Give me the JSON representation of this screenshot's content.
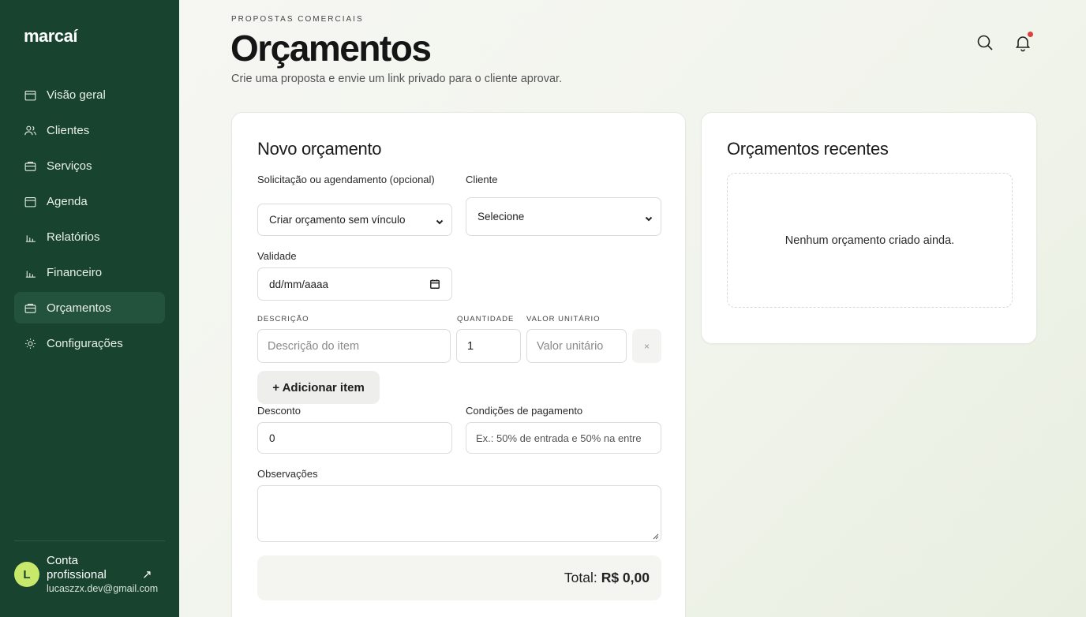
{
  "sidebar": {
    "logo": "marcaí",
    "items": [
      {
        "label": "Visão geral",
        "icon": "calendar-icon"
      },
      {
        "label": "Clientes",
        "icon": "users-icon"
      },
      {
        "label": "Serviços",
        "icon": "briefcase-icon"
      },
      {
        "label": "Agenda",
        "icon": "calendar-icon"
      },
      {
        "label": "Relatórios",
        "icon": "bar-chart-icon"
      },
      {
        "label": "Financeiro",
        "icon": "bar-chart-icon"
      },
      {
        "label": "Orçamentos",
        "icon": "briefcase-icon",
        "active": true
      },
      {
        "label": "Configurações",
        "icon": "sun-icon"
      }
    ],
    "account": {
      "avatar_initial": "L",
      "name": "Conta profissional",
      "email": "lucaszzx.dev@gmail.com",
      "arrow": "↗"
    }
  },
  "header": {
    "eyebrow": "PROPOSTAS COMERCIAIS",
    "title": "Orçamentos",
    "subtitle": "Crie uma proposta e envie um link privado para o cliente aprovar."
  },
  "form": {
    "title": "Novo orçamento",
    "request_label": "Solicitação ou agendamento (opcional)",
    "request_value": "Criar orçamento sem vínculo",
    "client_label": "Cliente",
    "client_value": "Selecione",
    "validity_label": "Validade",
    "validity_value": "dd/mm/aaaa",
    "col_description": "DESCRIÇÃO",
    "col_quantity": "QUANTIDADE",
    "col_unit_value": "VALOR UNITÁRIO",
    "item_description_placeholder": "Descrição do item",
    "item_quantity_value": "1",
    "item_unit_value_placeholder": "Valor unitário",
    "remove_label": "×",
    "add_item_label": "+  Adicionar item",
    "discount_label": "Desconto",
    "discount_value": "0",
    "payment_label": "Condições de pagamento",
    "payment_placeholder": "Ex.: 50% de entrada e 50% na entre",
    "notes_label": "Observações",
    "total_label": "Total:",
    "total_value": "R$ 0,00"
  },
  "recent": {
    "title": "Orçamentos recentes",
    "empty_text": "Nenhum orçamento criado ainda."
  },
  "colors": {
    "sidebar_bg": "#17432f",
    "active_item_bg": "#24533d",
    "avatar_bg": "#c7e86a",
    "notification_dot": "#d8433b"
  }
}
